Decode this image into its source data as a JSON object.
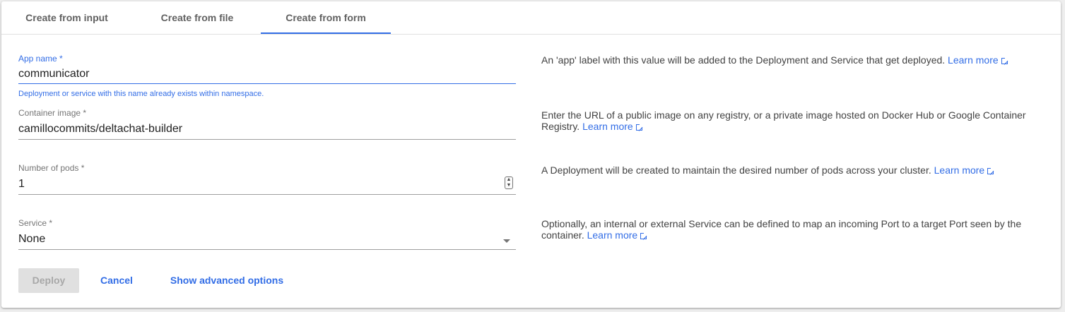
{
  "tabs": [
    {
      "label": "Create from input"
    },
    {
      "label": "Create from file"
    },
    {
      "label": "Create from form",
      "active": true
    }
  ],
  "form": {
    "app_name": {
      "label": "App name *",
      "value": "communicator",
      "hint": "Deployment or service with this name already exists within namespace."
    },
    "container_image": {
      "label": "Container image *",
      "value": "camillocommits/deltachat-builder"
    },
    "pods": {
      "label": "Number of pods *",
      "value": "1"
    },
    "service": {
      "label": "Service *",
      "value": "None"
    }
  },
  "help": {
    "app_name": "An 'app' label with this value will be added to the Deployment and Service that get deployed.",
    "container_image": "Enter the URL of a public image on any registry, or a private image hosted on Docker Hub or Google Container Registry.",
    "pods": "A Deployment will be created to maintain the desired number of pods across your cluster.",
    "service": "Optionally, an internal or external Service can be defined to map an incoming Port to a target Port seen by the container.",
    "learn_more": "Learn more"
  },
  "actions": {
    "deploy": "Deploy",
    "cancel": "Cancel",
    "advanced": "Show advanced options"
  },
  "colors": {
    "accent": "#326de6",
    "disabled_bg": "#e0e0e0",
    "disabled_text": "#a8a8a8"
  }
}
